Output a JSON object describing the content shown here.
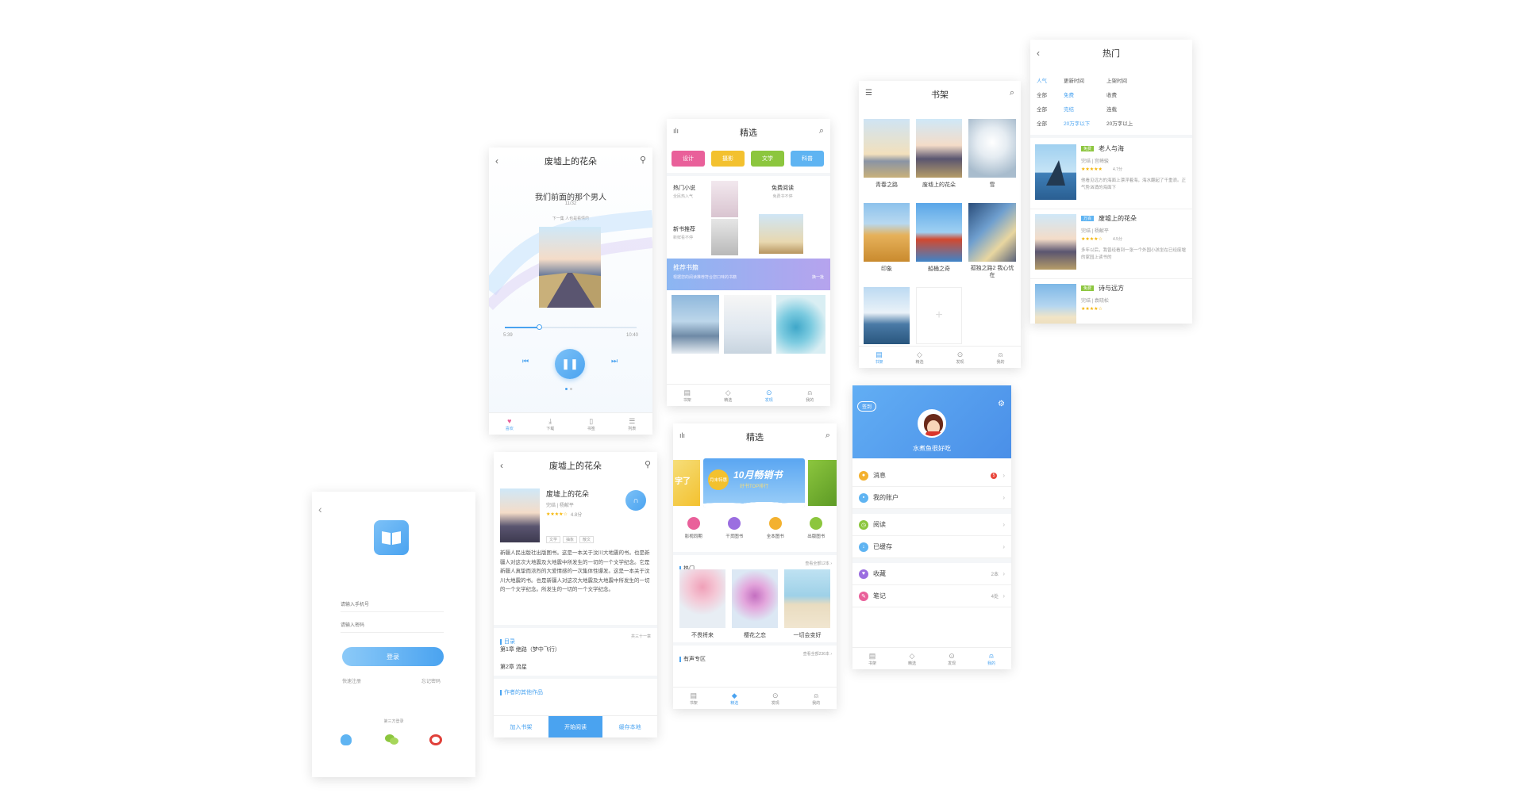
{
  "login": {
    "back": "‹",
    "phone_placeholder": "请输入手机号",
    "password_placeholder": "请输入密码",
    "login_button": "登录",
    "register": "快速注册",
    "forgot": "忘记密码",
    "third_party": "第三方登录"
  },
  "player": {
    "title": "废墟上的花朵",
    "song": "我们前面的那个男人",
    "page": "11/32",
    "hint": "下一集  人也是看情的",
    "time_current": "5:39",
    "time_total": "10:40",
    "progress": 0.26,
    "tabs": [
      "喜欢",
      "下载",
      "书签",
      "列表"
    ]
  },
  "detail": {
    "title": "废墟上的花朵",
    "book_title": "废墟上的花朵",
    "status": "完结 | 杨献平",
    "rating": "4.8分",
    "tags": [
      "文学",
      "抽象",
      "散文"
    ],
    "description": "新疆人民出版社出版图书。这是一本关于汶川大地震的书。也是新疆人对这次大地震及大地震中所发生的一切的一个文学纪念。它是新疆人真挚而浓烈的大爱情感的一次集体性爆发。这是一本关于汶川大地震的书。也是新疆人对这次大地震及大地震中所发生的一切的一个文学纪念。所发生的一切的一个文学纪念。",
    "toc_label": "目录",
    "toc_count": "共三十一章",
    "chapters": [
      "第1章  绝路（梦中飞行）",
      "第2章  流星"
    ],
    "other_works": "作者的其他作品",
    "btn_shelf": "加入书架",
    "btn_read": "开始阅读",
    "btn_cache": "缓存本地"
  },
  "select1": {
    "title": "精选",
    "chips": [
      {
        "label": "设计",
        "color": "#e9609a"
      },
      {
        "label": "摄影",
        "color": "#f3c12f"
      },
      {
        "label": "文学",
        "color": "#8cc63e"
      },
      {
        "label": "科普",
        "color": "#5fb4f2"
      }
    ],
    "hot_novel": "热门小说",
    "hot_novel_sub": "全民热入气",
    "free_read": "免费阅读",
    "free_read_sub": "免费书不停",
    "new_book": "新书推荐",
    "new_book_sub": "新鲜看不停",
    "recommend_title": "推荐书籍",
    "recommend_sub": "根据您的阅读推荐符合您口味的书籍",
    "refresh": "换一批",
    "tabs": [
      "书架",
      "精选",
      "发现",
      "我的"
    ]
  },
  "select2": {
    "title": "精选",
    "banner_title": "10月畅销书",
    "banner_sub": "好书TOP排行",
    "banner_badge": "月末特惠",
    "banner_left": "字了",
    "categories": [
      {
        "label": "影视同期",
        "color": "#e9609a"
      },
      {
        "label": "干货图书",
        "color": "#9b6ee0"
      },
      {
        "label": "全本图书",
        "color": "#f3b12f"
      },
      {
        "label": "出版图书",
        "color": "#8cc63e"
      }
    ],
    "hot": "热门",
    "hot_more": "查看全部12本 ›",
    "books": [
      "不畏将来",
      "樱花之恋",
      "一切会变好"
    ],
    "audio": "有声专区",
    "audio_more": "查看全部236本 ›",
    "tabs": [
      "书架",
      "精选",
      "发现",
      "我的"
    ]
  },
  "shelf": {
    "title": "书架",
    "books": [
      "青春之路",
      "废墟上的花朵",
      "雪",
      "印象",
      "船桶之奇",
      "孤独之路2 我心忧在"
    ],
    "tabs": [
      "书架",
      "精选",
      "发现",
      "我的"
    ]
  },
  "profile": {
    "sign": "签到",
    "username": "水煮鱼很好吃",
    "items": [
      {
        "label": "消息",
        "color": "#f3b12f",
        "count": ""
      },
      {
        "label": "我的账户",
        "color": "#5fb4f2",
        "count": ""
      },
      {
        "label": "阅读",
        "color": "#8cc63e",
        "count": ""
      },
      {
        "label": "已缓存",
        "color": "#5fb4f2",
        "count": ""
      },
      {
        "label": "收藏",
        "color": "#9b6ee0",
        "count": "2本"
      },
      {
        "label": "笔记",
        "color": "#e9609a",
        "count": "4处"
      }
    ],
    "tabs": [
      "书架",
      "精选",
      "发现",
      "我的"
    ]
  },
  "hot": {
    "title": "热门",
    "filters": [
      [
        "人气",
        "更新时间",
        "上架时间"
      ],
      [
        "全部",
        "免费",
        "收费"
      ],
      [
        "全部",
        "完结",
        "连载"
      ],
      [
        "全部",
        "20万字以下",
        "20万字以上"
      ]
    ],
    "items": [
      {
        "tag": "免费",
        "tag_color": "#8cc63e",
        "title": "老人与海",
        "status": "完结 | 宫崎骏",
        "rating": "4.7分",
        "desc": "他看见远方的海面上漂浮着海，海水翻起了千重浪。正气势汹涌的海面下"
      },
      {
        "tag": "万百",
        "tag_color": "#5fb4f2",
        "title": "废墟上的花朵",
        "status": "完结 | 杨献平",
        "rating": "4.5分",
        "desc": "多年以后，我曾经看到一张一个外国小孩坐在已经废墟的家园上读书的"
      },
      {
        "tag": "免费",
        "tag_color": "#8cc63e",
        "title": "诗与远方",
        "status": "完结 | 袁晓松",
        "rating": "4.3分",
        "desc": ""
      }
    ]
  }
}
